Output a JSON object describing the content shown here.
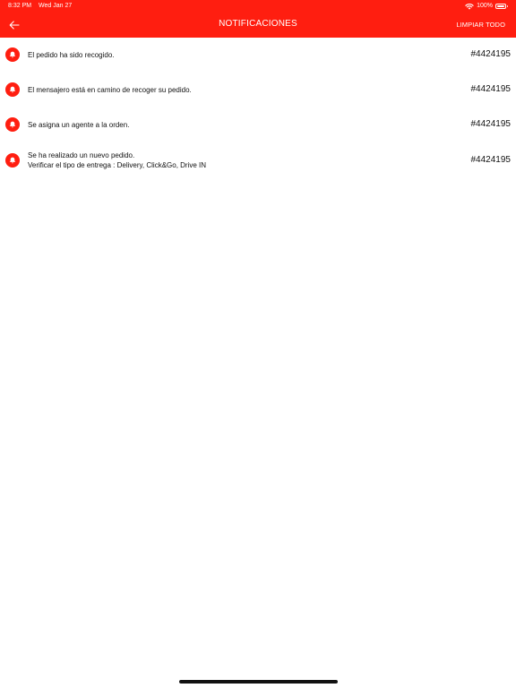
{
  "status_bar": {
    "time": "8:32 PM",
    "date": "Wed Jan 27",
    "battery": "100%"
  },
  "header": {
    "back_icon": "arrow-left-icon",
    "title": "NOTIFICACIONES",
    "clear_label": "LIMPIAR TODO",
    "accent_color": "#ff1e10"
  },
  "notifications": [
    {
      "icon": "bell-icon",
      "message": "El pedido ha sido recogido.",
      "order": "#4424195"
    },
    {
      "icon": "bell-icon",
      "message": "El mensajero está en camino de recoger su pedido.",
      "order": "#4424195"
    },
    {
      "icon": "bell-icon",
      "message": "Se asigna un agente a la orden.",
      "order": "#4424195"
    },
    {
      "icon": "bell-icon",
      "message": "Se ha realizado un nuevo pedido.",
      "message_line2": "Verificar el tipo de entrega : Delivery, Click&Go, Drive IN",
      "order": "#4424195"
    }
  ]
}
